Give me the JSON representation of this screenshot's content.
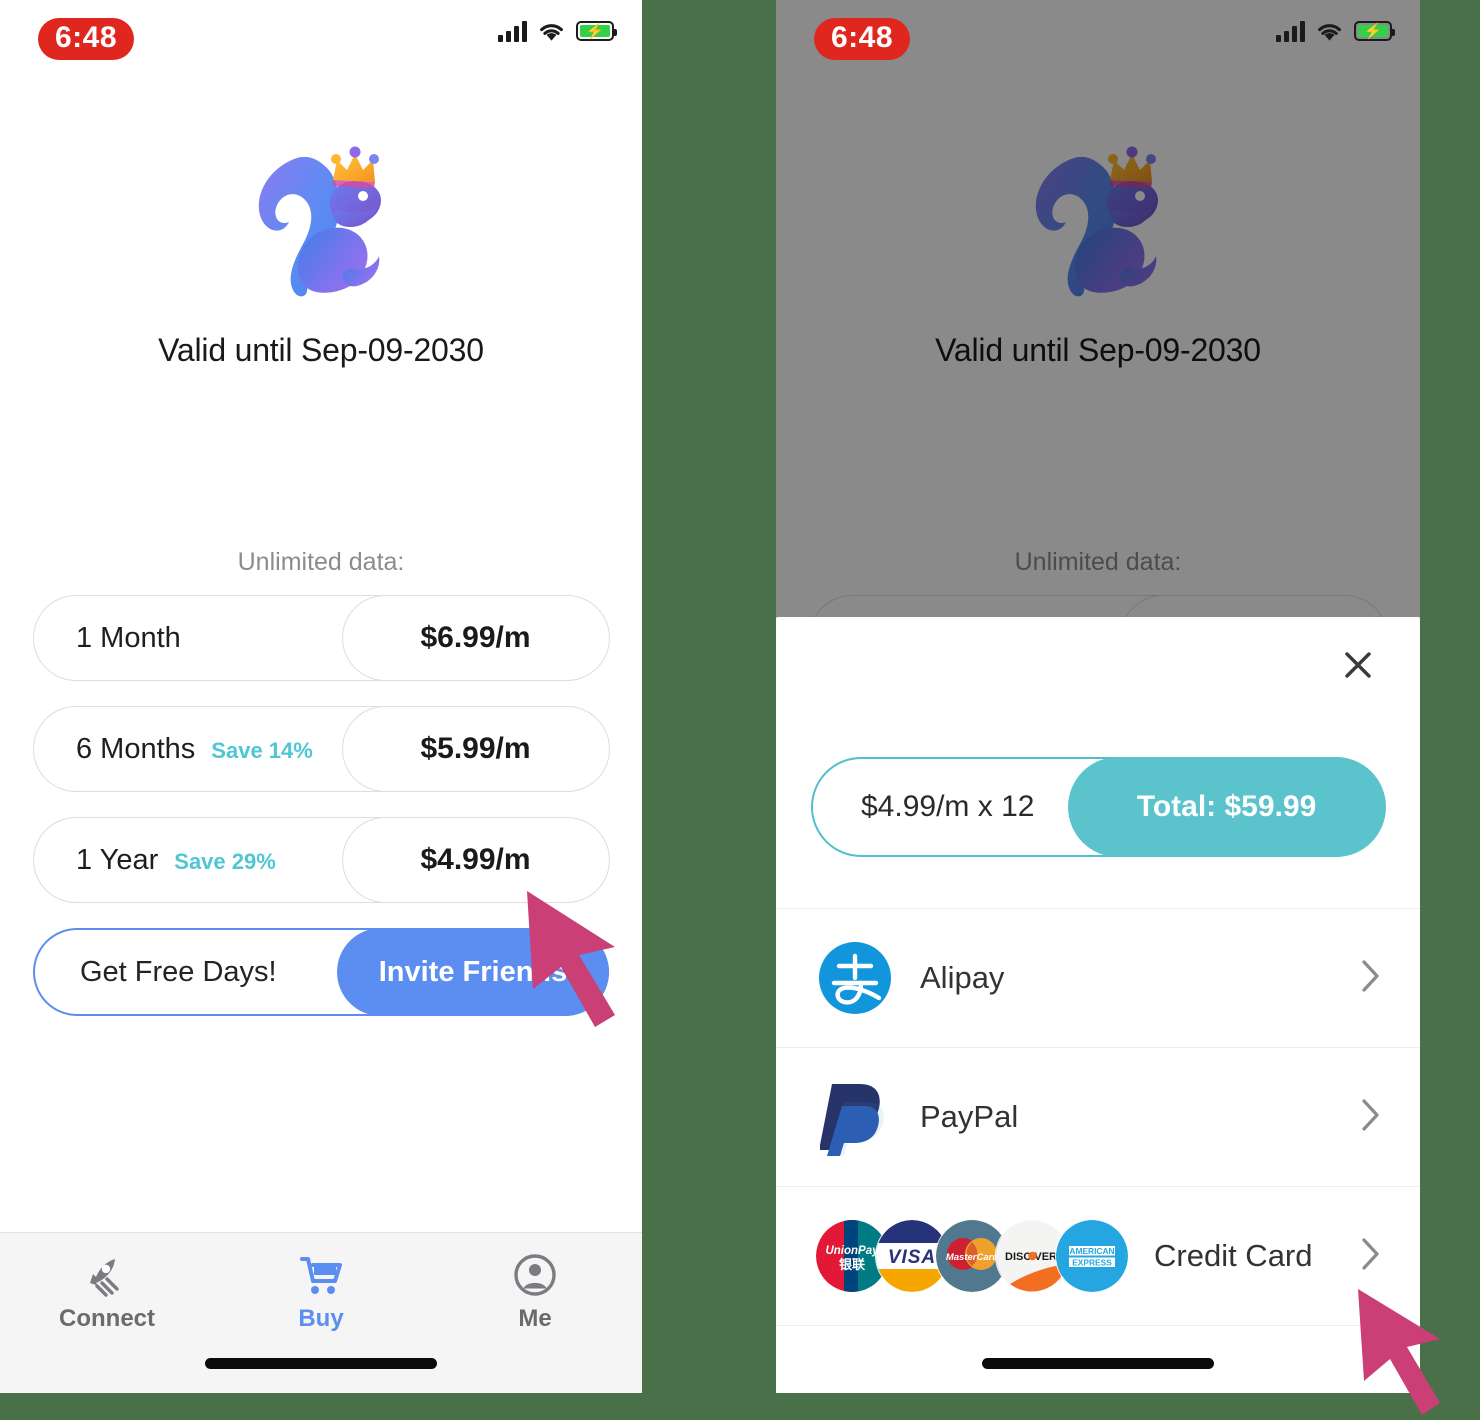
{
  "theme": {
    "background": "#4a7049",
    "accent_blue": "#5b8ef0",
    "accent_teal": "#5ac3cc",
    "save_teal": "#4fc6d4",
    "clock_red": "#e0271f",
    "cursor_pink": "#c93f76"
  },
  "left_phone": {
    "status": {
      "time": "6:48",
      "signal_icon": "cellular-bars-icon",
      "wifi_icon": "wifi-icon",
      "battery_icon": "battery-charging-icon"
    },
    "hero": {
      "logo_icon": "crowned-squirrel-logo",
      "valid_text": "Valid until Sep-09-2030"
    },
    "plans": {
      "title": "Unlimited data:",
      "items": [
        {
          "name": "1 Month",
          "save": "",
          "price": "$6.99/m"
        },
        {
          "name": "6 Months",
          "save": "Save 14%",
          "price": "$5.99/m"
        },
        {
          "name": "1 Year",
          "save": "Save 29%",
          "price": "$4.99/m"
        }
      ]
    },
    "invite": {
      "label": "Get Free Days!",
      "button": "Invite Friends"
    },
    "tabbar": {
      "items": [
        {
          "label": "Connect",
          "icon": "rocket-icon",
          "active": false
        },
        {
          "label": "Buy",
          "icon": "cart-icon",
          "active": true
        },
        {
          "label": "Me",
          "icon": "account-icon",
          "active": false
        }
      ]
    }
  },
  "right_phone": {
    "status": {
      "time": "6:48",
      "signal_icon": "cellular-bars-icon",
      "wifi_icon": "wifi-icon",
      "battery_icon": "battery-charging-icon"
    },
    "hero": {
      "logo_icon": "crowned-squirrel-logo",
      "valid_text": "Valid until Sep-09-2030"
    },
    "plans": {
      "title": "Unlimited data:"
    },
    "sheet": {
      "close_icon": "close-icon",
      "total": {
        "unit": "$4.99/m x 12",
        "amount": "Total: $59.99"
      },
      "methods": [
        {
          "label": "Alipay",
          "logo": "alipay-logo",
          "chevron": "chevron-right-icon"
        },
        {
          "label": "PayPal",
          "logo": "paypal-logo",
          "chevron": "chevron-right-icon"
        },
        {
          "label": "Credit Card",
          "logo": "credit-card-logos",
          "chevron": "chevron-right-icon",
          "cards": [
            "UnionPay",
            "VISA",
            "MasterCard",
            "DISCOVER",
            "AMERICAN EXPRESS"
          ]
        }
      ]
    }
  },
  "annotations": {
    "cursor_1": "click-arrow-on-1-year-plan",
    "cursor_2": "click-arrow-on-credit-card-row"
  }
}
